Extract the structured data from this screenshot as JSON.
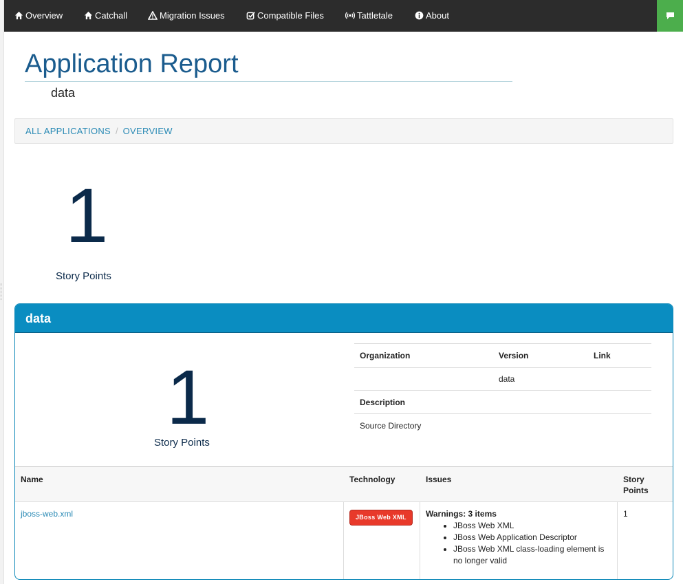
{
  "navbar": {
    "items": [
      {
        "label": "Overview",
        "icon": "home-icon"
      },
      {
        "label": "Catchall",
        "icon": "home-icon"
      },
      {
        "label": "Migration Issues",
        "icon": "warning-icon"
      },
      {
        "label": "Compatible Files",
        "icon": "check-square-icon"
      },
      {
        "label": "Tattletale",
        "icon": "broadcast-icon"
      },
      {
        "label": "About",
        "icon": "info-icon"
      }
    ],
    "chat_icon": "comment-icon",
    "chat_color": "#4cae4c"
  },
  "header": {
    "title": "Application Report",
    "subtitle": "data"
  },
  "breadcrumb": {
    "items": [
      "ALL APPLICATIONS",
      "OVERVIEW"
    ],
    "separator": "/"
  },
  "summary": {
    "story_points": "1",
    "story_points_label": "Story Points"
  },
  "panel": {
    "title": "data",
    "accent": "#0a8dc1",
    "story_points": "1",
    "story_points_label": "Story Points",
    "info": {
      "headers": {
        "organization": "Organization",
        "version": "Version",
        "link": "Link"
      },
      "values": {
        "organization": "",
        "version": "data",
        "link": ""
      },
      "description_label": "Description",
      "description": "Source Directory"
    },
    "files_table": {
      "columns": [
        "Name",
        "Technology",
        "Issues",
        "Story\nPoints"
      ],
      "rows": [
        {
          "name": "jboss-web.xml",
          "technology": "JBoss Web XML",
          "technology_color": "#e8392a",
          "issues_heading": "Warnings: 3 items",
          "issues": [
            "JBoss Web XML",
            "JBoss Web Application Descriptor",
            "JBoss Web XML class-loading element is no longer valid"
          ],
          "story_points": "1"
        }
      ]
    }
  }
}
